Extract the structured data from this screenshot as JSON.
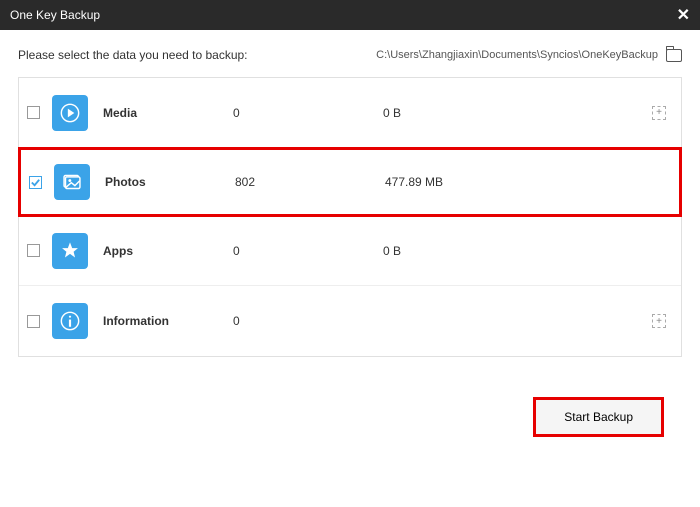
{
  "window": {
    "title": "One Key Backup"
  },
  "prompt": "Please select the data you need to backup:",
  "path": "C:\\Users\\Zhangjiaxin\\Documents\\Syncios\\OneKeyBackup",
  "items": [
    {
      "name": "Media",
      "count": "0",
      "size": "0 B",
      "checked": false,
      "icon": "play",
      "expandable": true,
      "highlighted": false
    },
    {
      "name": "Photos",
      "count": "802",
      "size": "477.89 MB",
      "checked": true,
      "icon": "photo",
      "expandable": false,
      "highlighted": true
    },
    {
      "name": "Apps",
      "count": "0",
      "size": "0 B",
      "checked": false,
      "icon": "apps",
      "expandable": false,
      "highlighted": false
    },
    {
      "name": "Information",
      "count": "0",
      "size": "",
      "checked": false,
      "icon": "info",
      "expandable": true,
      "highlighted": false
    }
  ],
  "buttons": {
    "start": "Start Backup"
  }
}
